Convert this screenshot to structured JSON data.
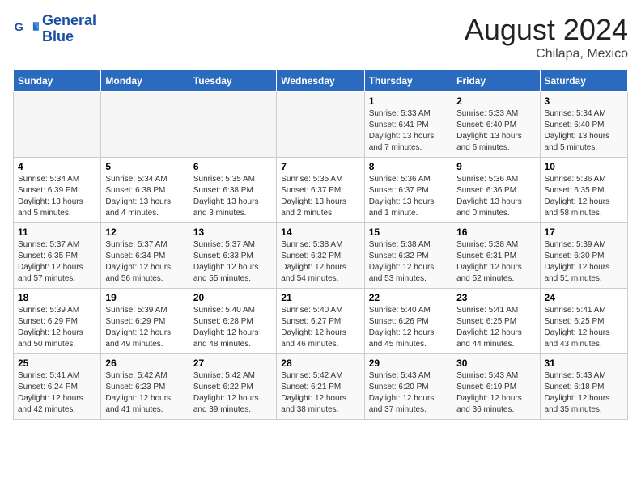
{
  "logo": {
    "line1": "General",
    "line2": "Blue"
  },
  "title": "August 2024",
  "location": "Chilapa, Mexico",
  "days_of_week": [
    "Sunday",
    "Monday",
    "Tuesday",
    "Wednesday",
    "Thursday",
    "Friday",
    "Saturday"
  ],
  "weeks": [
    [
      {
        "day": "",
        "info": ""
      },
      {
        "day": "",
        "info": ""
      },
      {
        "day": "",
        "info": ""
      },
      {
        "day": "",
        "info": ""
      },
      {
        "day": "1",
        "info": "Sunrise: 5:33 AM\nSunset: 6:41 PM\nDaylight: 13 hours and 7 minutes."
      },
      {
        "day": "2",
        "info": "Sunrise: 5:33 AM\nSunset: 6:40 PM\nDaylight: 13 hours and 6 minutes."
      },
      {
        "day": "3",
        "info": "Sunrise: 5:34 AM\nSunset: 6:40 PM\nDaylight: 13 hours and 5 minutes."
      }
    ],
    [
      {
        "day": "4",
        "info": "Sunrise: 5:34 AM\nSunset: 6:39 PM\nDaylight: 13 hours and 5 minutes."
      },
      {
        "day": "5",
        "info": "Sunrise: 5:34 AM\nSunset: 6:38 PM\nDaylight: 13 hours and 4 minutes."
      },
      {
        "day": "6",
        "info": "Sunrise: 5:35 AM\nSunset: 6:38 PM\nDaylight: 13 hours and 3 minutes."
      },
      {
        "day": "7",
        "info": "Sunrise: 5:35 AM\nSunset: 6:37 PM\nDaylight: 13 hours and 2 minutes."
      },
      {
        "day": "8",
        "info": "Sunrise: 5:36 AM\nSunset: 6:37 PM\nDaylight: 13 hours and 1 minute."
      },
      {
        "day": "9",
        "info": "Sunrise: 5:36 AM\nSunset: 6:36 PM\nDaylight: 13 hours and 0 minutes."
      },
      {
        "day": "10",
        "info": "Sunrise: 5:36 AM\nSunset: 6:35 PM\nDaylight: 12 hours and 58 minutes."
      }
    ],
    [
      {
        "day": "11",
        "info": "Sunrise: 5:37 AM\nSunset: 6:35 PM\nDaylight: 12 hours and 57 minutes."
      },
      {
        "day": "12",
        "info": "Sunrise: 5:37 AM\nSunset: 6:34 PM\nDaylight: 12 hours and 56 minutes."
      },
      {
        "day": "13",
        "info": "Sunrise: 5:37 AM\nSunset: 6:33 PM\nDaylight: 12 hours and 55 minutes."
      },
      {
        "day": "14",
        "info": "Sunrise: 5:38 AM\nSunset: 6:32 PM\nDaylight: 12 hours and 54 minutes."
      },
      {
        "day": "15",
        "info": "Sunrise: 5:38 AM\nSunset: 6:32 PM\nDaylight: 12 hours and 53 minutes."
      },
      {
        "day": "16",
        "info": "Sunrise: 5:38 AM\nSunset: 6:31 PM\nDaylight: 12 hours and 52 minutes."
      },
      {
        "day": "17",
        "info": "Sunrise: 5:39 AM\nSunset: 6:30 PM\nDaylight: 12 hours and 51 minutes."
      }
    ],
    [
      {
        "day": "18",
        "info": "Sunrise: 5:39 AM\nSunset: 6:29 PM\nDaylight: 12 hours and 50 minutes."
      },
      {
        "day": "19",
        "info": "Sunrise: 5:39 AM\nSunset: 6:29 PM\nDaylight: 12 hours and 49 minutes."
      },
      {
        "day": "20",
        "info": "Sunrise: 5:40 AM\nSunset: 6:28 PM\nDaylight: 12 hours and 48 minutes."
      },
      {
        "day": "21",
        "info": "Sunrise: 5:40 AM\nSunset: 6:27 PM\nDaylight: 12 hours and 46 minutes."
      },
      {
        "day": "22",
        "info": "Sunrise: 5:40 AM\nSunset: 6:26 PM\nDaylight: 12 hours and 45 minutes."
      },
      {
        "day": "23",
        "info": "Sunrise: 5:41 AM\nSunset: 6:25 PM\nDaylight: 12 hours and 44 minutes."
      },
      {
        "day": "24",
        "info": "Sunrise: 5:41 AM\nSunset: 6:25 PM\nDaylight: 12 hours and 43 minutes."
      }
    ],
    [
      {
        "day": "25",
        "info": "Sunrise: 5:41 AM\nSunset: 6:24 PM\nDaylight: 12 hours and 42 minutes."
      },
      {
        "day": "26",
        "info": "Sunrise: 5:42 AM\nSunset: 6:23 PM\nDaylight: 12 hours and 41 minutes."
      },
      {
        "day": "27",
        "info": "Sunrise: 5:42 AM\nSunset: 6:22 PM\nDaylight: 12 hours and 39 minutes."
      },
      {
        "day": "28",
        "info": "Sunrise: 5:42 AM\nSunset: 6:21 PM\nDaylight: 12 hours and 38 minutes."
      },
      {
        "day": "29",
        "info": "Sunrise: 5:43 AM\nSunset: 6:20 PM\nDaylight: 12 hours and 37 minutes."
      },
      {
        "day": "30",
        "info": "Sunrise: 5:43 AM\nSunset: 6:19 PM\nDaylight: 12 hours and 36 minutes."
      },
      {
        "day": "31",
        "info": "Sunrise: 5:43 AM\nSunset: 6:18 PM\nDaylight: 12 hours and 35 minutes."
      }
    ]
  ]
}
